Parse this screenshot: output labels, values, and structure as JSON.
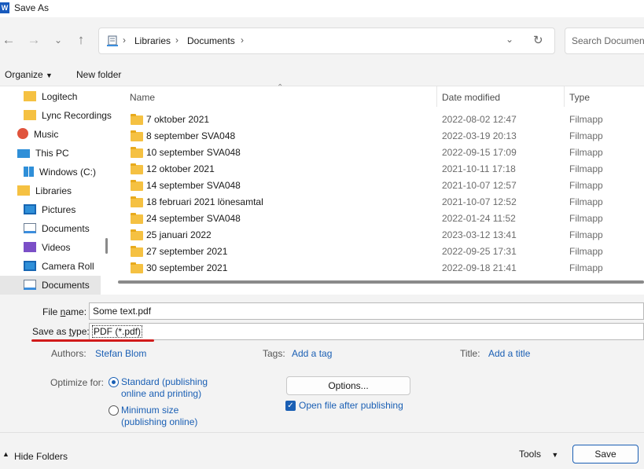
{
  "window": {
    "title": "Save As",
    "app_icon": "W"
  },
  "nav": {
    "breadcrumb": [
      "Libraries",
      "Documents"
    ],
    "search_placeholder": "Search Documents"
  },
  "toolbar": {
    "organize": "Organize",
    "new_folder": "New folder"
  },
  "sidebar": {
    "items": [
      {
        "label": "Logitech",
        "icon": "folder-icon"
      },
      {
        "label": "Lync Recordings",
        "icon": "folder-icon"
      },
      {
        "label": "Music",
        "icon": "music-icon"
      },
      {
        "label": "This PC",
        "icon": "pc-icon"
      },
      {
        "label": "Windows (C:)",
        "icon": "drive-icon"
      },
      {
        "label": "Libraries",
        "icon": "folder-icon"
      },
      {
        "label": "Pictures",
        "icon": "pictures-icon"
      },
      {
        "label": "Documents",
        "icon": "documents-icon"
      },
      {
        "label": "Videos",
        "icon": "videos-icon"
      },
      {
        "label": "Camera Roll",
        "icon": "pictures-icon"
      },
      {
        "label": "Documents",
        "icon": "documents-icon",
        "selected": true
      }
    ]
  },
  "columns": {
    "name": "Name",
    "date": "Date modified",
    "type": "Type"
  },
  "files": [
    {
      "name": "7 oktober 2021",
      "date": "2022-08-02 12:47",
      "type": "Filmapp"
    },
    {
      "name": "8 september SVA048",
      "date": "2022-03-19 20:13",
      "type": "Filmapp"
    },
    {
      "name": "10 september SVA048",
      "date": "2022-09-15 17:09",
      "type": "Filmapp"
    },
    {
      "name": "12 oktober 2021",
      "date": "2021-10-11 17:18",
      "type": "Filmapp"
    },
    {
      "name": "14 september SVA048",
      "date": "2021-10-07 12:57",
      "type": "Filmapp"
    },
    {
      "name": "18 februari 2021 lönesamtal",
      "date": "2021-10-07 12:52",
      "type": "Filmapp"
    },
    {
      "name": "24 september SVA048",
      "date": "2022-01-24 11:52",
      "type": "Filmapp"
    },
    {
      "name": "25 januari 2022",
      "date": "2023-03-12 13:41",
      "type": "Filmapp"
    },
    {
      "name": "27 september 2021",
      "date": "2022-09-25 17:31",
      "type": "Filmapp"
    },
    {
      "name": "30 september 2021",
      "date": "2022-09-18 21:41",
      "type": "Filmapp"
    }
  ],
  "form": {
    "file_name_label_pre": "File ",
    "file_name_label_u": "n",
    "file_name_label_post": "ame:",
    "file_name_value": "Some text.pdf",
    "save_type_label_pre": "Save as ",
    "save_type_label_u": "t",
    "save_type_label_post": "ype:",
    "save_type_value": "PDF (*.pdf)",
    "authors_label": "Authors:",
    "authors_value": "Stefan Blom",
    "tags_label": "Tags:",
    "tags_value": "Add a tag",
    "title_label": "Title:",
    "title_value": "Add a title",
    "optimize_label": "Optimize for:",
    "standard_line1": "Standard (publishing",
    "standard_line2": "online and printing)",
    "minimum_line1": "Minimum size",
    "minimum_line2": "(publishing online)",
    "options_button": "Options...",
    "open_after_label": "Open file after publishing"
  },
  "footer": {
    "hide_folders": "Hide Folders",
    "tools": "Tools",
    "save": "Save"
  },
  "colors": {
    "accent": "#1a5fb4",
    "underline": "#d11b1b",
    "folder": "#f5c142"
  }
}
